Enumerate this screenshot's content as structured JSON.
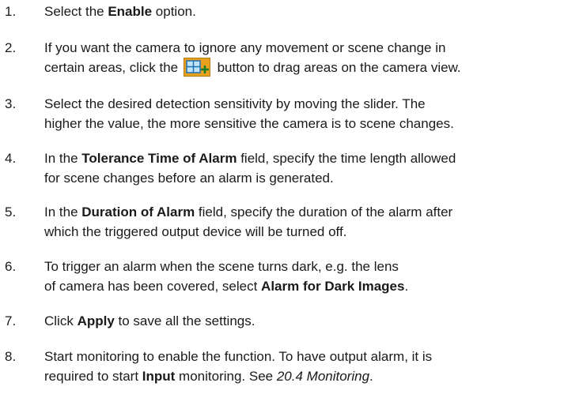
{
  "steps": [
    {
      "num": "1.",
      "a": "Select the ",
      "b": "Enable",
      "c": " option."
    },
    {
      "num": "2.",
      "line1": "If you want the camera to ignore any movement or scene change in",
      "pre": "certain areas, click the ",
      "post": " button to drag areas on the camera view.",
      "icon": "add-grid-area-icon"
    },
    {
      "num": "3.",
      "line1": "Select the desired detection sensitivity by moving the slider. The",
      "line2": "higher the value, the more sensitive the camera is to scene changes."
    },
    {
      "num": "4.",
      "a": "In the ",
      "b": "Tolerance Time of Alarm",
      "c": " field, specify the time length allowed",
      "line2": "for scene changes before an alarm is generated."
    },
    {
      "num": "5.",
      "a": "In the ",
      "b": "Duration of Alarm",
      "c": " field, specify the duration of the alarm after",
      "line2": "which the triggered output device will be turned off."
    },
    {
      "num": "6.",
      "line1": "To trigger an alarm when the scene turns dark, e.g. the lens",
      "a": "of camera has been covered, select ",
      "b": "Alarm for Dark Images",
      "c": "."
    },
    {
      "num": "7.",
      "a": "Click ",
      "b": "Apply",
      "c": " to save all the settings."
    },
    {
      "num": "8.",
      "line1": "Start monitoring to enable the function. To have output alarm, it is",
      "a": "required to start ",
      "b": "Input",
      "c": " monitoring. See ",
      "ref": "20.4 Monitoring",
      "d": "."
    }
  ],
  "colors": {
    "icon_bg": "#e8a11f",
    "icon_grid": "#1f6fb3",
    "icon_plus": "#1a7a2a"
  }
}
